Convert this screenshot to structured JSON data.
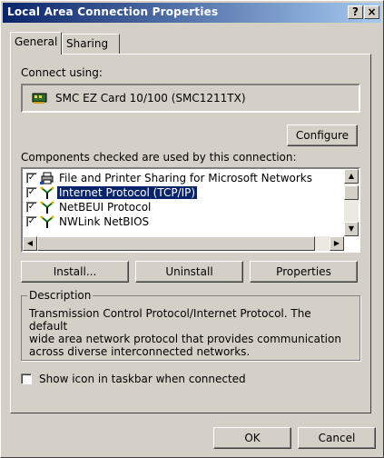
{
  "window": {
    "title": "Local Area Connection Properties",
    "help_glyph": "?",
    "close_glyph": "×"
  },
  "tabs": [
    {
      "label": "General",
      "active": true
    },
    {
      "label": "Sharing",
      "active": false
    }
  ],
  "connect": {
    "label": "Connect using:",
    "adapter": "SMC EZ Card 10/100 (SMC1211TX)",
    "configure_label": "Configure"
  },
  "components": {
    "label": "Components checked are used by this connection:",
    "items": [
      {
        "label": "File and Printer Sharing for Microsoft Networks",
        "checked": true,
        "icon": "printer-network-icon",
        "selected": false
      },
      {
        "label": "Internet Protocol (TCP/IP)",
        "checked": true,
        "icon": "network-protocol-icon",
        "selected": true
      },
      {
        "label": "NetBEUI Protocol",
        "checked": true,
        "icon": "network-protocol-icon",
        "selected": false
      },
      {
        "label": "NWLink NetBIOS",
        "checked": true,
        "icon": "network-protocol-icon",
        "selected": false
      }
    ]
  },
  "actions": {
    "install": "Install...",
    "uninstall": "Uninstall",
    "properties": "Properties"
  },
  "description": {
    "title": "Description",
    "lines": [
      "Transmission Control Protocol/Internet Protocol. The default",
      "wide area network protocol that provides communication",
      "across diverse interconnected networks."
    ]
  },
  "taskbar": {
    "label": "Show icon in taskbar when connected",
    "checked": false
  },
  "footer": {
    "ok": "OK",
    "cancel": "Cancel"
  },
  "colors": {
    "title_start": "#0a246a",
    "title_end": "#a6caf0",
    "selection": "#0a246a",
    "face": "#d4d0c8"
  }
}
